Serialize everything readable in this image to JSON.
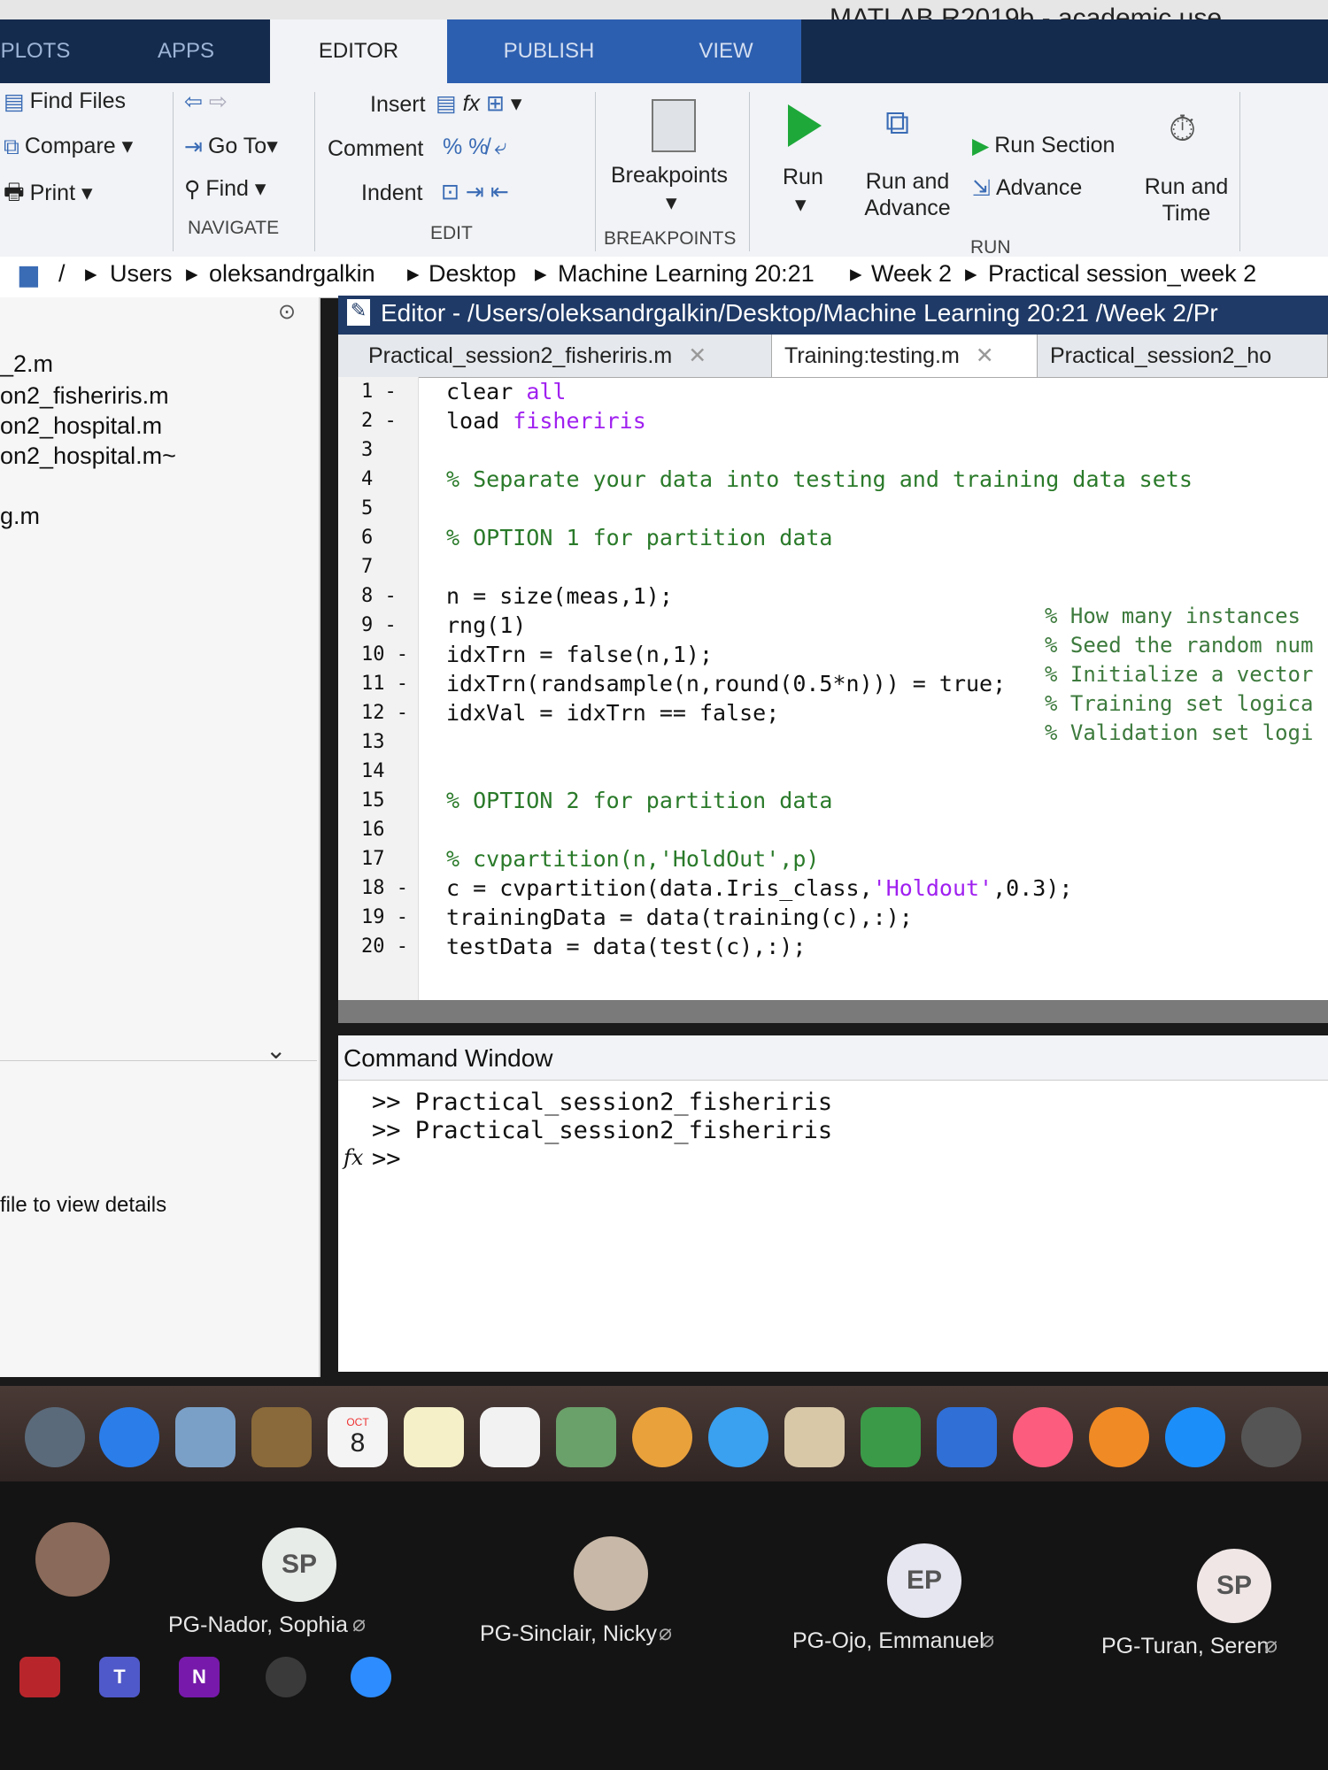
{
  "app_title": "MATLAB R2019b - academic use",
  "toolstrip_tabs": [
    "PLOTS",
    "APPS",
    "EDITOR",
    "PUBLISH",
    "VIEW"
  ],
  "ribbon": {
    "file": {
      "find_files": "Find Files",
      "compare": "Compare",
      "print": "Print"
    },
    "navigate": {
      "go_to": "Go To",
      "find": "Find",
      "label": "NAVIGATE"
    },
    "edit": {
      "insert": "Insert",
      "comment": "Comment",
      "indent": "Indent",
      "label": "EDIT"
    },
    "breakpoints": {
      "button": "Breakpoints",
      "label": "BREAKPOINTS"
    },
    "run": {
      "run": "Run",
      "run_and_advance": "Run and Advance",
      "run_section": "Run Section",
      "advance": "Advance",
      "run_and_time": "Run and Time",
      "label": "RUN"
    }
  },
  "address_bar": {
    "root": "/",
    "crumbs": [
      "Users",
      "oleksandrgalkin",
      "Desktop",
      "Machine Learning 20:21",
      "Week 2",
      "Practical session_week 2"
    ]
  },
  "current_folder": {
    "files": [
      "_2.m",
      "on2_fisheriris.m",
      "on2_hospital.m",
      "on2_hospital.m~",
      "g.m"
    ],
    "details_hint": "file to view details"
  },
  "editor": {
    "title": "Editor - /Users/oleksandrgalkin/Desktop/Machine Learning 20:21 /Week 2/Pr",
    "tabs": [
      {
        "label": "Practical_session2_fisheriris.m",
        "active": false
      },
      {
        "label": "Training:testing.m",
        "active": true
      },
      {
        "label": "Practical_session2_ho",
        "active": false
      }
    ],
    "line_numbers": [
      "1 -",
      "2 -",
      "3",
      "4",
      "5",
      "6",
      "7",
      "8 -",
      "9 -",
      "10 -",
      "11 -",
      "12 -",
      "13",
      "14",
      "15",
      "16",
      "17",
      "18 -",
      "19 -",
      "20 -"
    ],
    "code": {
      "l1_a": "clear ",
      "l1_b": "all",
      "l2_a": "load ",
      "l2_b": "fisheriris",
      "l4": "% Separate your data into testing and training data sets",
      "l6": "% OPTION 1 for partition data",
      "l8": "n = size(meas,1);",
      "l9": "rng(1)",
      "l10": "idxTrn = false(n,1);",
      "l11": "idxTrn(randsample(n,round(0.5*n))) = true;",
      "l12": "idxVal = idxTrn == false;",
      "l15": "% OPTION 2 for partition data",
      "l17": "% cvpartition(n,'HoldOut',p)",
      "l18_a": "c = cvpartition(data.Iris_class,",
      "l18_b": "'Holdout'",
      "l18_c": ",0.3);",
      "l19": "trainingData = data(training(c),:);",
      "l20": "testData = data(test(c),:);"
    },
    "comments": {
      "c8": "% How many instances",
      "c9": "% Seed the random num",
      "c10": "% Initialize a vector",
      "c11": "% Training set logica",
      "c12": "% Validation set logi"
    }
  },
  "command_window": {
    "title": "Command Window",
    "lines": [
      ">> Practical_session2_fisheriris",
      ">> Practical_session2_fisheriris"
    ],
    "prompt": ">>",
    "fx": "fx"
  },
  "dock": {
    "calendar_month": "OCT",
    "calendar_day": "8"
  },
  "meeting": {
    "participants": [
      {
        "name": "",
        "initials": ""
      },
      {
        "name": "PG-Nador, Sophia",
        "initials": "SP"
      },
      {
        "name": "PG-Sinclair, Nicky",
        "initials": ""
      },
      {
        "name": "PG-Ojo, Emmanuel",
        "initials": "EP"
      },
      {
        "name": "PG-Turan, Seren",
        "initials": "SP"
      }
    ]
  },
  "taskbar": {
    "teams": "T",
    "onenote": "N"
  },
  "colors": {
    "toolstrip": "#152b4d",
    "editor_title": "#1f3a66",
    "comment": "#2a7a2a",
    "string": "#a020f0",
    "keyword": "#0b2ecb"
  }
}
